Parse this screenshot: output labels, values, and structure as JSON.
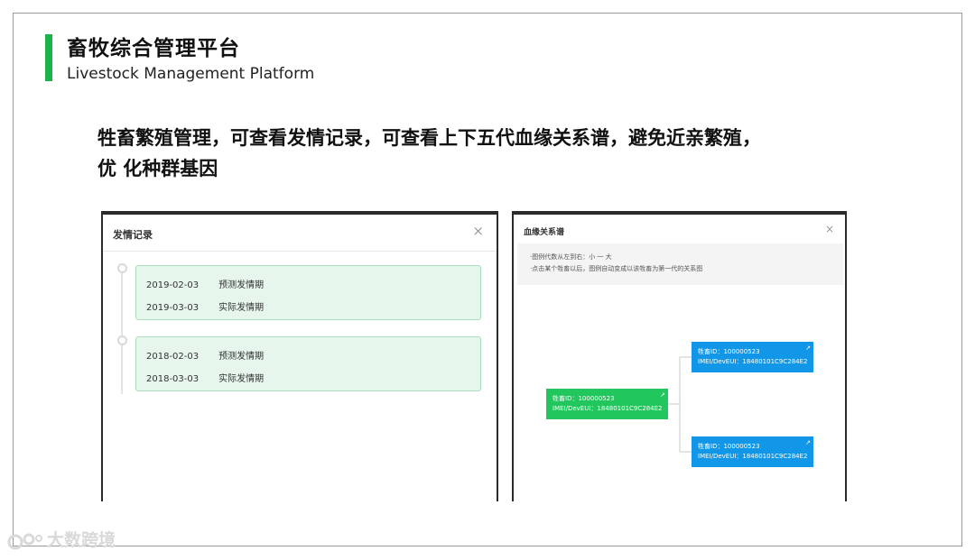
{
  "header": {
    "title": "畜牧综合管理平台",
    "subtitle": "Livestock Management Platform",
    "accent_color": "#1bb24a"
  },
  "description": {
    "line1": "牲畜繁殖管理，可查看发情记录，可查看上下五代血缘关系谱，避免近亲繁殖，",
    "line2": "优 化种群基因"
  },
  "estrus_dialog": {
    "title": "发情记录",
    "close_icon": "close-icon",
    "records": [
      {
        "date_predicted": "2019-02-03",
        "label_predicted": "预测发情期",
        "date_actual": "2019-03-03",
        "label_actual": "实际发情期"
      },
      {
        "date_predicted": "2018-02-03",
        "label_predicted": "预测发情期",
        "date_actual": "2018-03-03",
        "label_actual": "实际发情期"
      }
    ],
    "card_color": "#e6f6ec"
  },
  "lineage_dialog": {
    "title": "血缘关系谱",
    "close_icon": "close-icon",
    "notice_line1": "·图例代数从左到右：小 一 大",
    "notice_line2": "·点击某个牲畜以后，图例自动变成以该牲畜为第一代的关系图",
    "nodes": [
      {
        "id_line": "牲畜ID：100000523",
        "imei_line": "IMEI/DevEUI：18480101C9C284E2",
        "color": "#21c75c"
      },
      {
        "id_line": "牲畜ID：100000523",
        "imei_line": "IMEI/DevEUI：18480101C9C284E2",
        "color": "#1296e8"
      },
      {
        "id_line": "牲畜ID：100000523",
        "imei_line": "IMEI/DevEUI：18480101C9C284E2",
        "color": "#1296e8"
      }
    ]
  },
  "watermark": {
    "text": "大数跨境"
  }
}
